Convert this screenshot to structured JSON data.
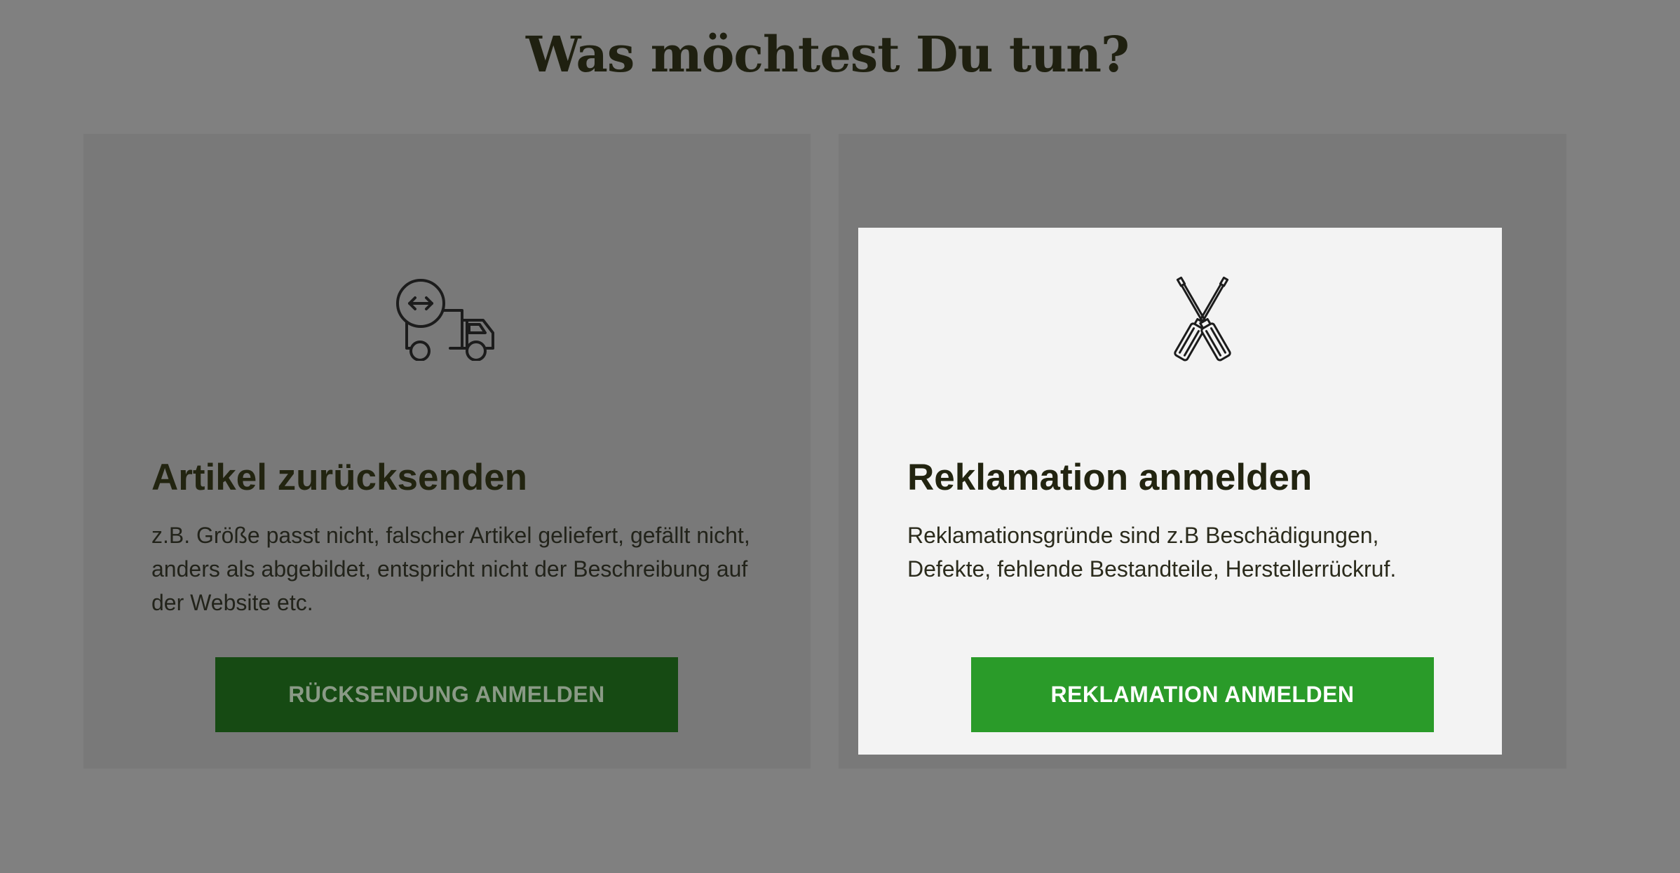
{
  "page": {
    "title": "Was möchtest Du tun?"
  },
  "cards": [
    {
      "icon": "return-truck-icon",
      "heading": "Artikel zurücksenden",
      "description": "z.B. Größe passt nicht, falscher Artikel geliefert, gefällt nicht, anders als abgebildet, entspricht nicht der Beschreibung auf der Website etc.",
      "button_label": "RÜCKSENDUNG ANMELDEN",
      "highlighted": false
    },
    {
      "icon": "screwdrivers-icon",
      "heading": "Reklamation anmelden",
      "description": "Reklamationsgründe sind z.B Beschädigungen, Defekte, fehlende Bestandteile, Herstellerrückruf.",
      "button_label": "REKLAMATION ANMELDEN",
      "highlighted": true
    }
  ],
  "colors": {
    "overlay": "#808080",
    "accent_green": "#2a9b29",
    "heading_text": "#222410"
  }
}
